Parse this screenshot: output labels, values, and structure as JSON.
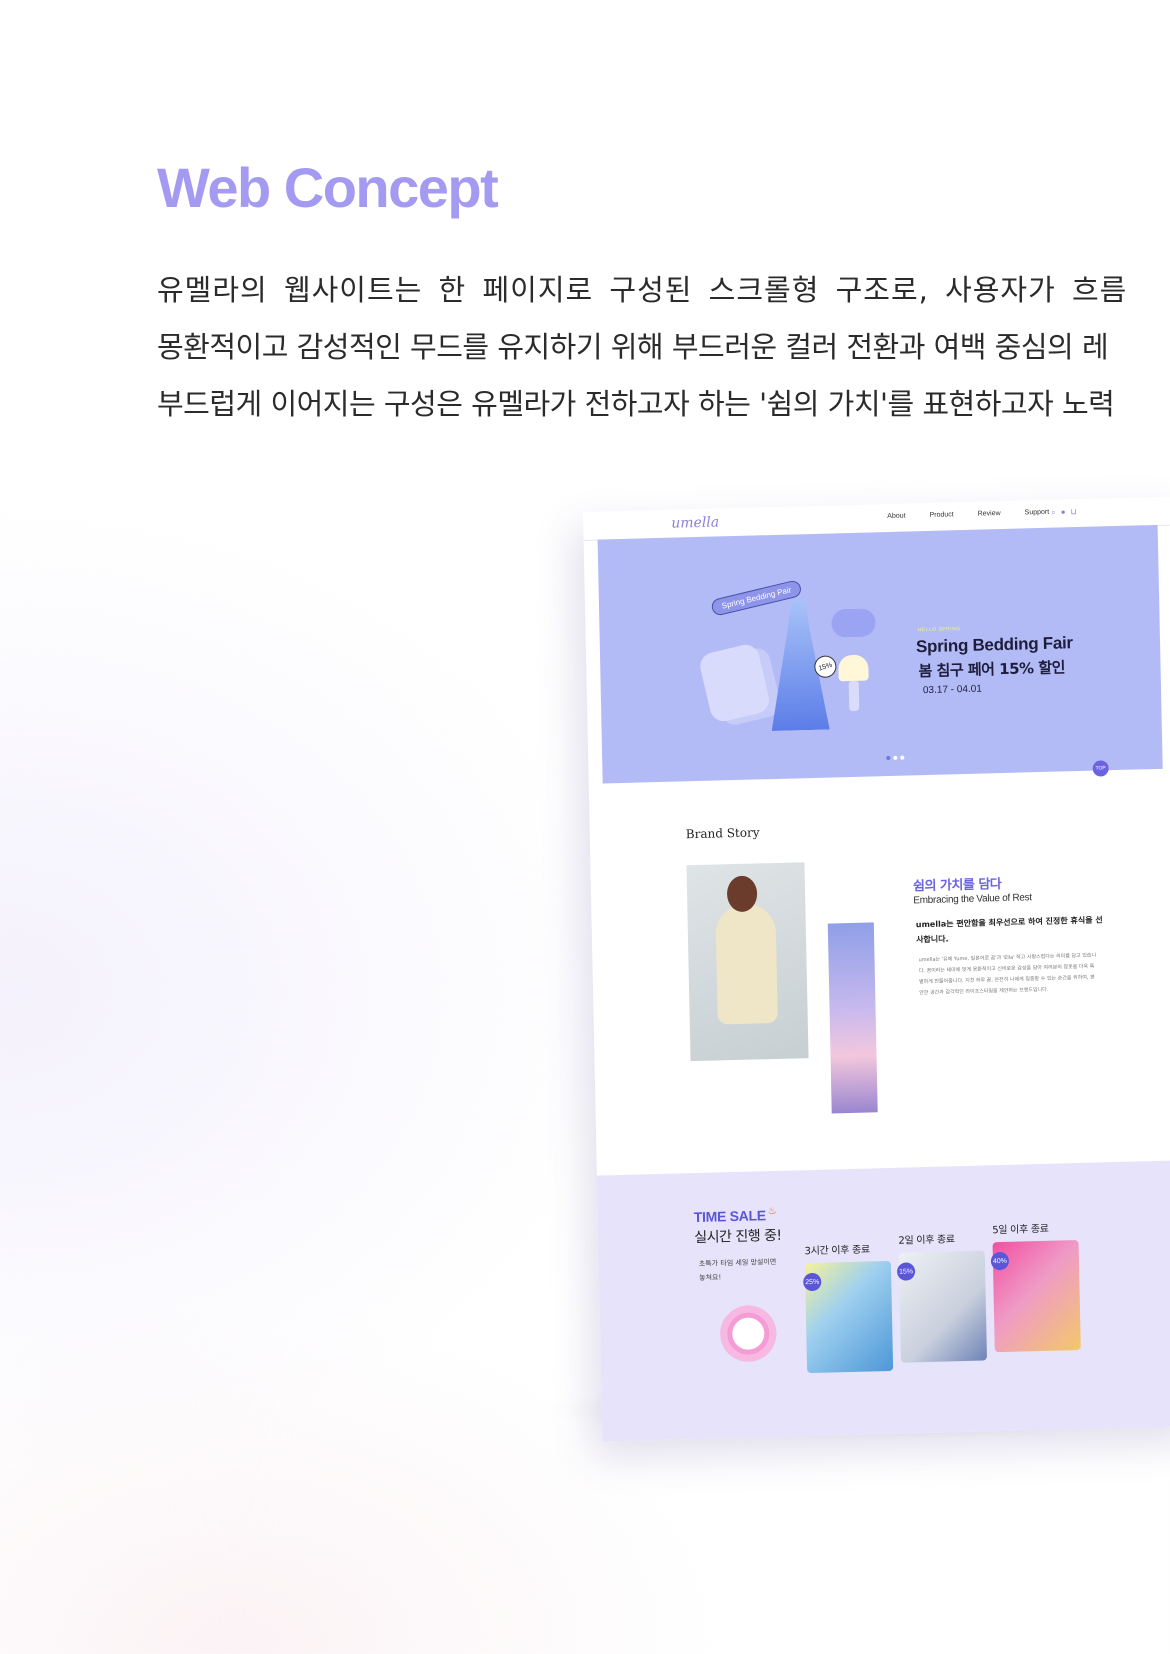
{
  "section": {
    "title": "Web Concept",
    "description": [
      "유멜라의 웹사이트는 한 페이지로 구성된 스크롤형 구조로, 사용자가 흐름",
      "몽환적이고 감성적인 무드를 유지하기 위해 부드러운 컬러 전환과 여백 중심의 레",
      "부드럽게 이어지는 구성은 유멜라가 전하고자 하는 '쉼의 가치'를 표현하고자 노력"
    ]
  },
  "mockup": {
    "logo": "umella",
    "nav": [
      "About",
      "Product",
      "Review",
      "Support"
    ],
    "nav_icons": [
      "search-icon",
      "user-icon",
      "cart-icon"
    ],
    "hero": {
      "badge": "Spring Bedding Pair",
      "discount_badge": "15%",
      "eyebrow": "HELLO SPRING",
      "title": "Spring Bedding Fair",
      "subtitle": "봄 침구 페어 15% 할인",
      "date": "03.17 - 04.01",
      "active_slide": 1,
      "slide_count": 3
    },
    "top_button": "TOP",
    "brand_story": {
      "title": "Brand Story",
      "heading": "쉼의 가치를 담다",
      "heading_en": "Embracing the Value of Rest",
      "lead": "umella는 편안함을 최우선으로 하여 진정한 휴식을 선사합니다.",
      "body": "umella는 '유메 Yume, 일본어로 꿈'과 'Ella' 작고 사랑스럽다는 의미를 담고 있습니다. 꿈이라는 테마에 맞게 몽환적이고 신비로운 감성을 담아 여러분의 잠옷을 더욱 특별하게 만들어줍니다. 지친 하루 끝, 온전히 나에게 집중할 수 있는 순간을 위하여, 편안한 공간과 감각적인 라이프스타일을 제안하는 브랜드입니다."
    },
    "time_sale": {
      "title": "TIME SALE",
      "title_icon": "fire-icon",
      "subtitle": "실시간 진행 중!",
      "note": "초특가 타임 세일 망설이면 놓쳐요!",
      "cards": [
        {
          "label": "3시간 이후 종료",
          "discount": "25%"
        },
        {
          "label": "2일 이후 종료",
          "discount": "15%"
        },
        {
          "label": "5일 이후 종료",
          "discount": "40%"
        }
      ]
    }
  },
  "colors": {
    "accent": "#a59af2",
    "hero_bg": "#b3bbf6",
    "brand_purple": "#6c63e0",
    "sale_bg": "#e6e3fb"
  }
}
